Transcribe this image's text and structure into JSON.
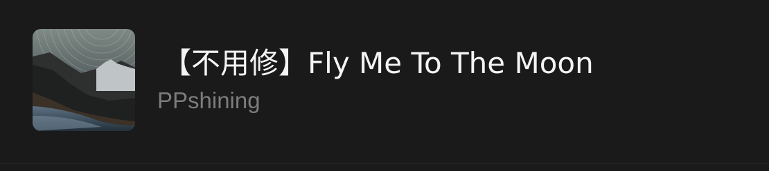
{
  "track": {
    "title": "【不用修】Fly Me To The Moon",
    "artist": "PPshining",
    "artwork_icon": "album-artwork-star-trails-mountain-lake"
  },
  "colors": {
    "background": "#1b1a1a",
    "title_text": "#f4f4f4",
    "artist_text": "#7d7c7c"
  }
}
